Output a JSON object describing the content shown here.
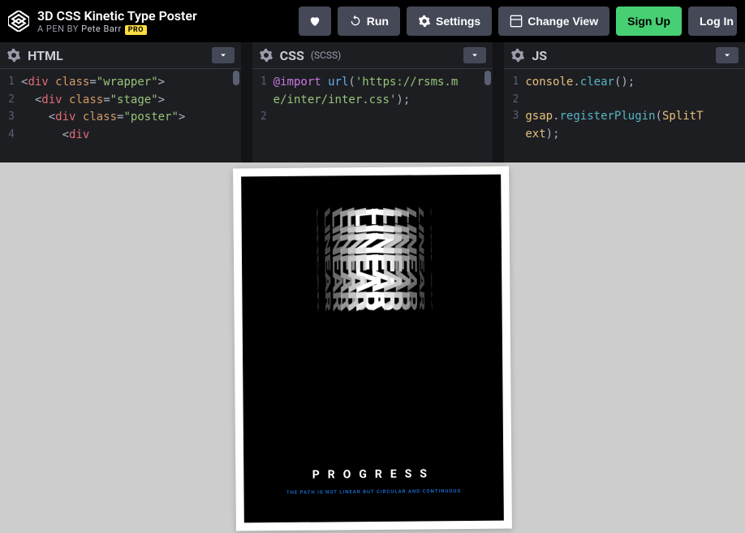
{
  "header": {
    "title": "3D CSS Kinetic Type Poster",
    "byline_prefix": "A PEN BY ",
    "author": "Pete Barr",
    "pro_badge": "PRO"
  },
  "toolbar": {
    "run": "Run",
    "settings": "Settings",
    "change_view": "Change View",
    "signup": "Sign Up",
    "login": "Log In"
  },
  "editors": {
    "html": {
      "title": "HTML",
      "lines": [
        {
          "n": "1",
          "html": "<span class='tok-punct'>&lt;</span><span class='tok-tag'>div</span> <span class='tok-attr'>class</span><span class='tok-punct'>=</span><span class='tok-string'>\"wrapper\"</span><span class='tok-punct'>&gt;</span>"
        },
        {
          "n": "2",
          "html": "  <span class='tok-punct'>&lt;</span><span class='tok-tag'>div</span> <span class='tok-attr'>class</span><span class='tok-punct'>=</span><span class='tok-string'>\"stage\"</span><span class='tok-punct'>&gt;</span>"
        },
        {
          "n": "3",
          "html": "    <span class='tok-punct'>&lt;</span><span class='tok-tag'>div</span> <span class='tok-attr'>class</span><span class='tok-punct'>=</span><span class='tok-string'>\"poster\"</span><span class='tok-punct'>&gt;</span>"
        },
        {
          "n": "4",
          "html": "      <span class='tok-punct'>&lt;</span><span class='tok-tag'>div</span>"
        }
      ]
    },
    "css": {
      "title": "CSS",
      "subtitle": "(SCSS)",
      "lines": [
        {
          "n": "1",
          "html": "<span class='tok-keyword'>@import</span> <span class='tok-func'>url</span><span class='tok-punct'>(</span><span class='tok-string'>'https://rsms.me/inter/inter.css'</span><span class='tok-punct'>);</span>"
        },
        {
          "n": "2",
          "html": ""
        }
      ]
    },
    "js": {
      "title": "JS",
      "lines": [
        {
          "n": "1",
          "html": "<span class='tok-obj'>console</span><span class='tok-punct'>.</span><span class='tok-method'>clear</span><span class='tok-punct'>();</span>"
        },
        {
          "n": "2",
          "html": ""
        },
        {
          "n": "3",
          "html": "<span class='tok-obj'>gsap</span><span class='tok-punct'>.</span><span class='tok-method'>registerPlugin</span><span class='tok-punct'>(</span><span class='tok-obj'>SplitText</span><span class='tok-punct'>);</span>"
        }
      ]
    }
  },
  "poster": {
    "kinetic_word": "LINEAR",
    "title": "PROGRESS",
    "subtitle": "THE PATH IS NOT LINEAR BUT CIRCULAR AND CONTINUOUS"
  }
}
